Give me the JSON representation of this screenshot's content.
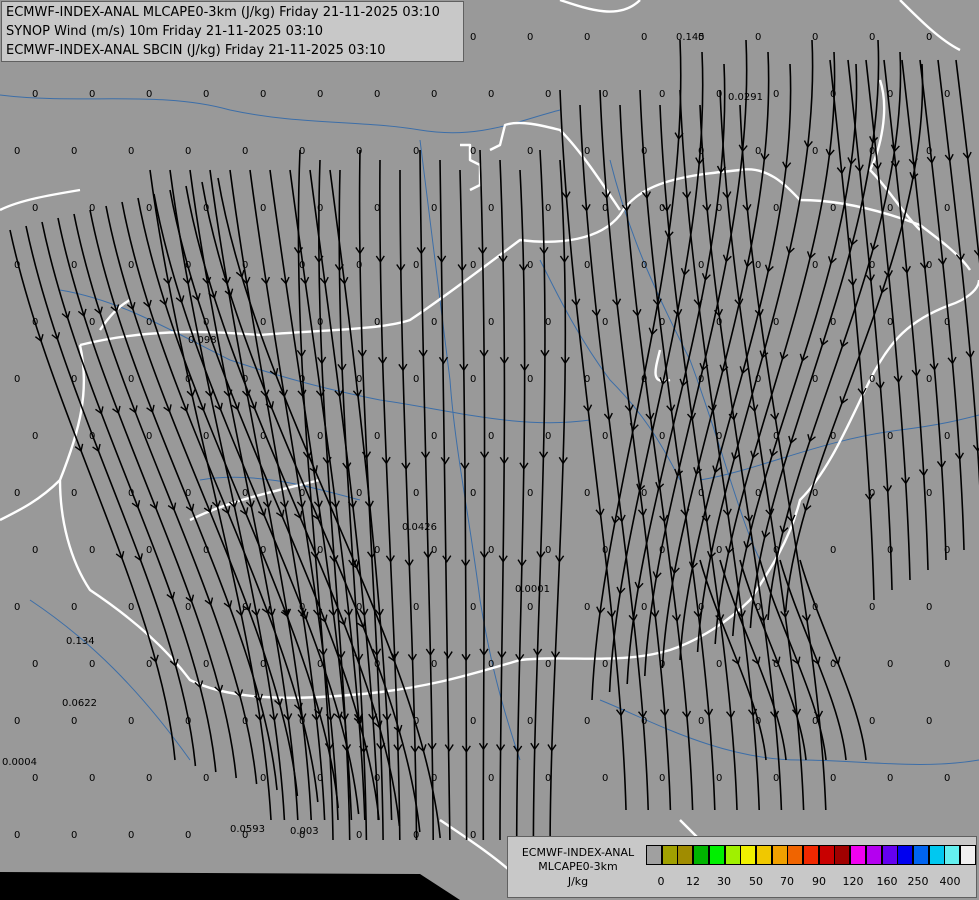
{
  "header": {
    "lines": [
      "ECMWF-INDEX-ANAL MLCAPE0-3km (J/kg) Friday 21-11-2025 03:10",
      "SYNOP Wind (m/s) 10m Friday 21-11-2025 03:10",
      "ECMWF-INDEX-ANAL SBCIN (J/kg) Friday 21-11-2025 03:10"
    ]
  },
  "legend": {
    "title_lines": [
      "ECMWF-INDEX-ANAL",
      "MLCAPE0-3km",
      "J/kg"
    ],
    "colors": [
      "#a0a0a0",
      "#a0a000",
      "#a08c00",
      "#00b400",
      "#00f000",
      "#a0f000",
      "#f0f000",
      "#f0c800",
      "#f0a000",
      "#f06400",
      "#f02800",
      "#c80000",
      "#a00000",
      "#f000f0",
      "#b400f0",
      "#6400f0",
      "#0000f0",
      "#0064f0",
      "#00c8f0",
      "#64f0f0",
      "#f0f0f0"
    ],
    "tick_labels": [
      "0",
      "12",
      "30",
      "50",
      "70",
      "90",
      "120",
      "160",
      "250",
      "400"
    ]
  },
  "colors": {
    "background": "#999999",
    "border": "#ffffff",
    "river": "#3c6ea8",
    "streamline": "#000000"
  },
  "map_values": [
    "0.145",
    "0.0291",
    "0.098",
    "0.0426",
    "0.0001",
    "0.134",
    "0.0622",
    "0.0004",
    "0.0593",
    "0.003"
  ]
}
